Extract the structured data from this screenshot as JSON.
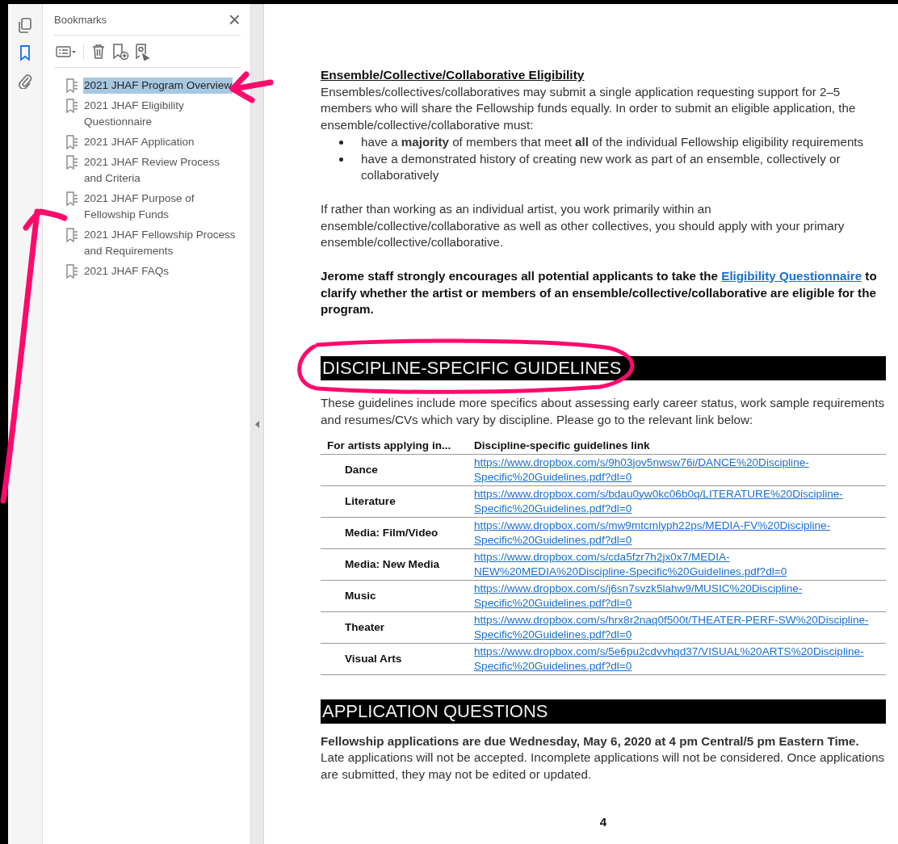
{
  "rail_tools": [
    {
      "kind": "pages",
      "selected": false
    },
    {
      "kind": "bookmarks",
      "selected": true
    },
    {
      "kind": "attachments",
      "selected": false
    }
  ],
  "bookmarks_panel": {
    "title": "Bookmarks",
    "close": "×",
    "items": [
      {
        "label": "2021 JHAF Program Overview",
        "selected": true
      },
      {
        "label": "2021 JHAF Eligibility Questionnaire",
        "selected": false
      },
      {
        "label": "2021 JHAF Application",
        "selected": false
      },
      {
        "label": "2021 JHAF Review Process and Criteria",
        "selected": false
      },
      {
        "label": "2021 JHAF Purpose of Fellowship Funds",
        "selected": false
      },
      {
        "label": "2021 JHAF Fellowship Process and Requirements",
        "selected": false
      },
      {
        "label": "2021 JHAF FAQs",
        "selected": false
      }
    ]
  },
  "document": {
    "subheading": "Ensemble/Collective/Collaborative Eligibility",
    "intro": "Ensembles/collectives/collaboratives may submit a single application requesting support for 2–5 members who will share the Fellowship funds equally. In order to submit an eligible application, the ensemble/collective/collaborative must:",
    "bullets": [
      "have a **majority** of members that meet **all** of the individual Fellowship eligibility requirements",
      "have a demonstrated history of creating new work as part of an ensemble, collectively or collaboratively"
    ],
    "paragraph": "If rather than working as an individual artist, you work primarily within an ensemble/collective/collaborative as well as other collectives, you should apply with your primary ensemble/collective/collaborative.",
    "callout": {
      "before": "Jerome staff strongly encourages all potential applicants to take the",
      "link": "Eligibility Questionnaire",
      "after": "to clarify whether the artist or members of an ensemble/collective/collaborative are eligible for the program."
    },
    "section_1": {
      "heading": "DISCIPLINE-SPECIFIC GUIDELINES",
      "text": "These guidelines include more specifics about assessing early career status, work sample requirements and resumes/CVs which vary by discipline. Please go to the relevant link below:"
    },
    "table": {
      "columns": [
        "For artists applying in...",
        "Discipline-specific guidelines link"
      ],
      "rows": [
        {
          "discipline": "Dance",
          "link": "https://www.dropbox.com/s/9h03jov5nwsw76i/DANCE%20Discipline-Specific%20Guidelines.pdf?dl=0"
        },
        {
          "discipline": "Literature",
          "link": "https://www.dropbox.com/s/bdau0yw0kc06b0q/LITERATURE%20Discipline-Specific%20Guidelines.pdf?dl=0"
        },
        {
          "discipline": "Media: Film/Video",
          "link": "https://www.dropbox.com/s/mw9mtcmlyph22ps/MEDIA-FV%20Discipline-Specific%20Guidelines.pdf?dl=0"
        },
        {
          "discipline": "Media: New Media",
          "link": "https://www.dropbox.com/s/cda5fzr7h2jx0x7/MEDIA-NEW%20MEDIA%20Discipline-Specific%20Guidelines.pdf?dl=0"
        },
        {
          "discipline": "Music",
          "link": "https://www.dropbox.com/s/j6sn7svzk5lahw9/MUSIC%20Discipline-Specific%20Guidelines.pdf?dl=0"
        },
        {
          "discipline": "Theater",
          "link": "https://www.dropbox.com/s/hrx8r2naq0f500t/THEATER-PERF-SW%20Discipline-Specific%20Guidelines.pdf?dl=0"
        },
        {
          "discipline": "Visual Arts",
          "link": "https://www.dropbox.com/s/5e6pu2cdvvhqd37/VISUAL%20ARTS%20Discipline-Specific%20Guidelines.pdf?dl=0"
        }
      ]
    },
    "section_2": {
      "heading": "APPLICATION QUESTIONS",
      "text": "**Fellowship applications are due Wednesday, May 6, 2020 at 4 pm Central/5 pm Eastern Time.** Late applications will not be accepted. Incomplete applications will not be considered. Once applications are submitted, they may not be edited or updated."
    },
    "page_number": "4"
  }
}
